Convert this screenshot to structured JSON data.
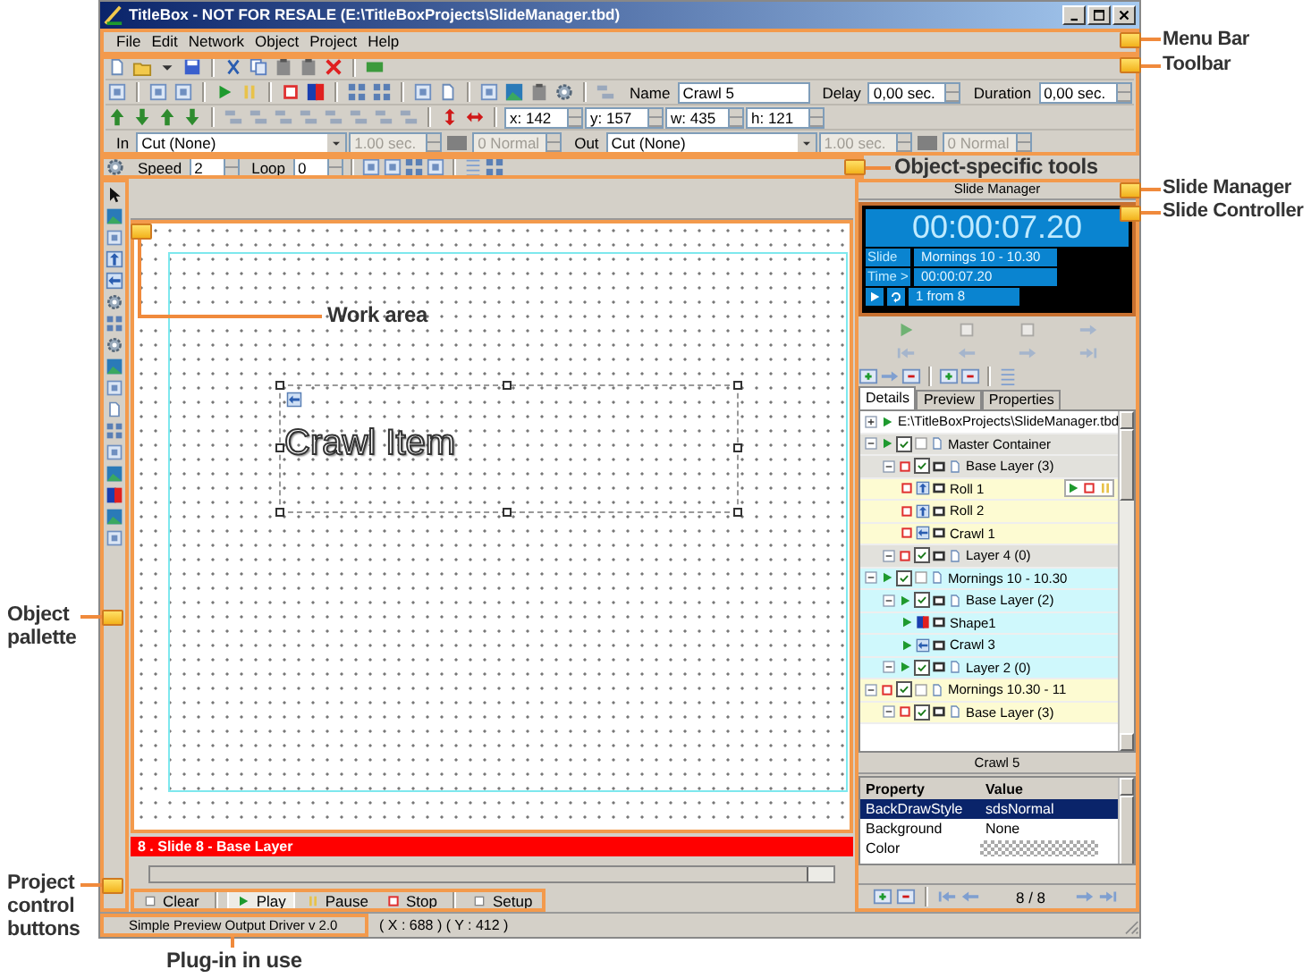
{
  "window": {
    "title": "TitleBox - NOT FOR RESALE (E:\\TitleBoxProjects\\SlideManager.tbd)"
  },
  "menu": [
    "File",
    "Edit",
    "Network",
    "Object",
    "Project",
    "Help"
  ],
  "toolbar": {
    "name": {
      "label": "Name",
      "value": "Crawl 5"
    },
    "delay": {
      "label": "Delay",
      "value": "0,00 sec."
    },
    "duration": {
      "label": "Duration",
      "value": "0,00 sec."
    },
    "geometry": [
      "x: 142",
      "y: 157",
      "w: 435",
      "h: 121"
    ],
    "transitions": [
      {
        "label": "In",
        "effect": "Cut (None)",
        "time": "1.00 sec.",
        "mode": "0 Normal",
        "disabled": true
      },
      {
        "label": "Out",
        "effect": "Cut (None)",
        "time": "1.00 sec.",
        "mode": "0 Normal",
        "disabled": true
      }
    ]
  },
  "object_tools": {
    "speed": {
      "label": "Speed",
      "value": "2"
    },
    "loop": {
      "label": "Loop",
      "value": "0"
    }
  },
  "canvas": {
    "item_text": "Crawl Item",
    "layer_bar": "8 . Slide 8 - Base Layer"
  },
  "controls": [
    {
      "kind": "clear",
      "label": "Clear",
      "active": false
    },
    {
      "kind": "play",
      "label": "Play",
      "active": true
    },
    {
      "kind": "pause",
      "label": "Pause",
      "active": false
    },
    {
      "kind": "stop",
      "label": "Stop",
      "active": false
    },
    {
      "kind": "setup",
      "label": "Setup",
      "active": false
    }
  ],
  "status_bar": {
    "plugin": "Simple Preview Output Driver v 2.0",
    "coords": "( X : 688 ) ( Y : 412 )"
  },
  "slide_manager": {
    "title": "Slide Manager",
    "clock": "00:00:07.20",
    "info": [
      {
        "label": "Slide",
        "value": "Mornings 10 - 10.30"
      },
      {
        "label": "Time >",
        "value": "00:00:07.20"
      }
    ],
    "count": "1 from 8",
    "tabs": [
      {
        "label": "Details",
        "selected": true
      },
      {
        "label": "Preview",
        "selected": false
      },
      {
        "label": "Properties",
        "selected": false
      }
    ],
    "tree": [
      {
        "label": "E:\\TitleBoxProjects\\SlideManager.tbd",
        "kind": "file",
        "expanded": false,
        "playing": true,
        "color": "#ffffff",
        "controls": false
      },
      {
        "label": "Master Container",
        "kind": "container",
        "expanded": true,
        "playing": true,
        "checked": true,
        "color": "#e2e1dc",
        "controls": false,
        "children": [
          {
            "label": "Base Layer (3)",
            "kind": "layer",
            "expanded": true,
            "playing": false,
            "checked": true,
            "color": "#e2e1dc",
            "controls": false,
            "children": [
              {
                "label": "Roll 1",
                "kind": "roll",
                "playing": false,
                "color": "#fdfbd2",
                "controls": true
              },
              {
                "label": "Roll 2",
                "kind": "roll",
                "playing": false,
                "color": "#fdfbd2",
                "controls": false
              },
              {
                "label": "Crawl 1",
                "kind": "crawl",
                "playing": false,
                "color": "#fdfbd2",
                "controls": false
              }
            ]
          },
          {
            "label": "Layer 4 (0)",
            "kind": "layer",
            "expanded": true,
            "playing": false,
            "checked": true,
            "color": "#e2e1dc",
            "controls": false
          }
        ]
      },
      {
        "label": "Mornings 10 - 10.30",
        "kind": "container",
        "expanded": true,
        "playing": true,
        "checked": true,
        "color": "#cff8fc",
        "controls": false,
        "children": [
          {
            "label": "Base Layer (2)",
            "kind": "layer",
            "expanded": true,
            "playing": true,
            "checked": true,
            "color": "#cff8fc",
            "controls": false,
            "children": [
              {
                "label": "Shape1",
                "kind": "shape",
                "playing": true,
                "color": "#cff8fc",
                "controls": false
              },
              {
                "label": "Crawl 3",
                "kind": "crawl",
                "playing": true,
                "color": "#cff8fc",
                "controls": false
              }
            ]
          },
          {
            "label": "Layer 2 (0)",
            "kind": "layer",
            "expanded": true,
            "playing": true,
            "checked": true,
            "color": "#cff8fc",
            "controls": false
          }
        ]
      },
      {
        "label": "Mornings 10.30 - 11",
        "kind": "container",
        "expanded": true,
        "playing": false,
        "checked": true,
        "color": "#fdfbd2",
        "controls": false,
        "children": [
          {
            "label": "Base Layer (3)",
            "kind": "layer",
            "expanded": true,
            "playing": false,
            "checked": true,
            "color": "#fdfbd2",
            "controls": false
          }
        ]
      }
    ],
    "object_title": "Crawl 5",
    "properties": {
      "columns": [
        "Property",
        "Value"
      ],
      "rows": [
        {
          "name": "BackDrawStyle",
          "kind": "text",
          "value": "sdsNormal",
          "selected": true
        },
        {
          "name": "Background",
          "kind": "text",
          "value": "None",
          "selected": false
        },
        {
          "name": "Color",
          "kind": "swatch",
          "selected": false
        }
      ]
    },
    "page": "8 / 8"
  },
  "callouts": [
    {
      "kind": "menu",
      "text": "Menu Bar"
    },
    {
      "kind": "toolbar",
      "text": "Toolbar"
    },
    {
      "kind": "objtools",
      "text": "Object-specific tools"
    },
    {
      "kind": "slidemgr",
      "text": "Slide Manager"
    },
    {
      "kind": "controller",
      "text": "Slide Controller"
    },
    {
      "kind": "workarea",
      "text": "Work area"
    },
    {
      "kind": "palette",
      "text": "Object pallette"
    },
    {
      "kind": "buttons",
      "text": "Project control buttons"
    },
    {
      "kind": "plugin",
      "text": "Plug-in in use"
    }
  ]
}
